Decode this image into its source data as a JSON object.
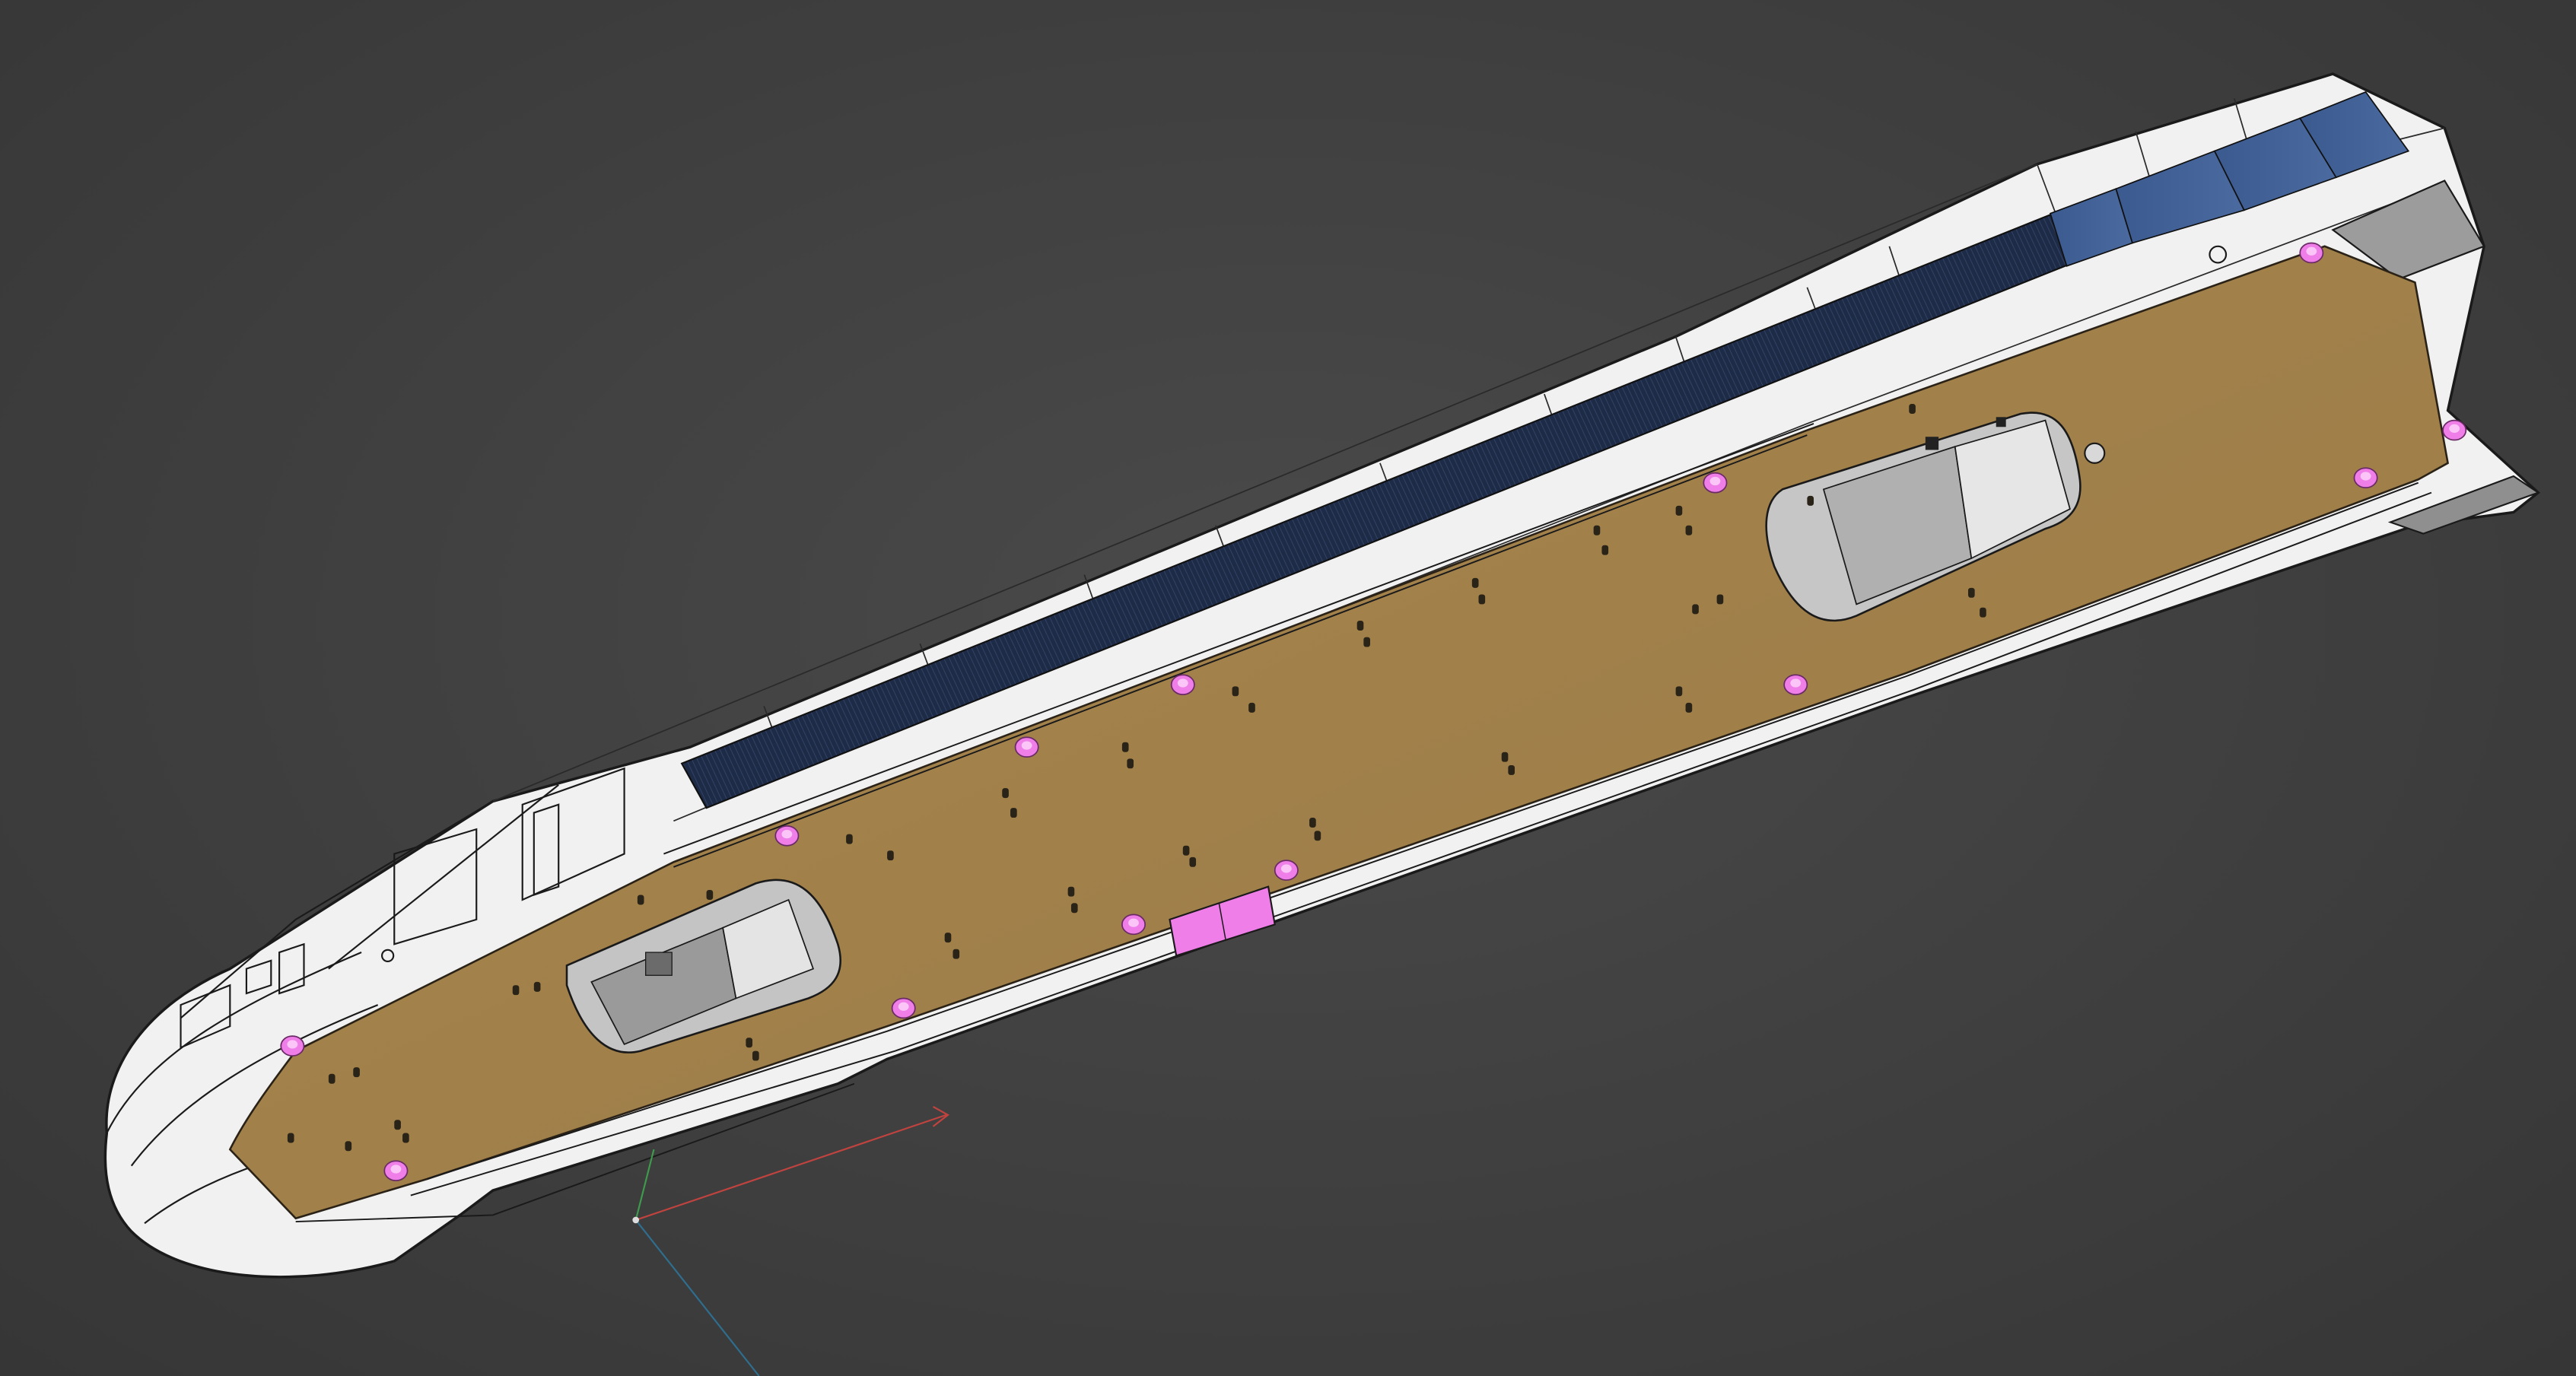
{
  "viewport": {
    "background": "#434343",
    "object": "train-nose-car-shell-3d-model",
    "colors": {
      "shell_white": "#f2f2f2",
      "outline": "#1a1a1a",
      "floor": "#a07f4a",
      "glass_dark": "#1d2c4d",
      "glass_blue": "#3e5d92",
      "interior_grey": "#b9b9b9",
      "highlight_pink": "#f07ee8",
      "axis_x": "#c0433f",
      "axis_y": "#3e9a4c",
      "axis_z": "#2f6e8e"
    }
  },
  "axis_gizmo": {
    "x_label": "",
    "y_label": "",
    "z_label": ""
  }
}
